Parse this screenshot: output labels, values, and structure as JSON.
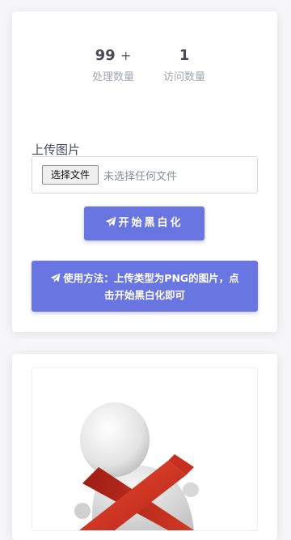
{
  "stats": {
    "processed": {
      "value": "99",
      "suffix": "+",
      "label": "处理数量"
    },
    "visits": {
      "value": "1",
      "label": "访问数量"
    }
  },
  "upload": {
    "label": "上传图片",
    "choose_button": "选择文件",
    "status": "未选择任何文件"
  },
  "actions": {
    "start_label": "开始黑白化",
    "start_icon": "paper-plane-icon"
  },
  "info": {
    "text": "使用方法：上传类型为PNG的图片，点击开始黑白化即可",
    "icon": "paper-plane-icon"
  },
  "preview": {
    "image": "figure-with-red-x-illustration"
  },
  "colors": {
    "accent": "#6975e0",
    "text": "#474b5b",
    "muted": "#a3a7b2"
  }
}
